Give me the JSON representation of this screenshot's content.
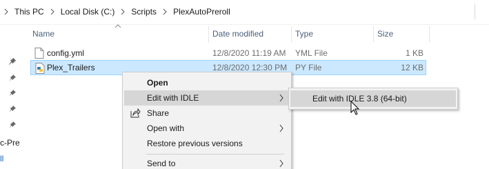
{
  "breadcrumb": [
    "This PC",
    "Local Disk (C:)",
    "Scripts",
    "PlexAutoPreroll"
  ],
  "nav_fragments": [
    "c-Pre",
    "ll"
  ],
  "columns": [
    "Name",
    "Date modified",
    "Type",
    "Size"
  ],
  "files": [
    {
      "name": "config.yml",
      "date": "12/8/2020 11:19 AM",
      "type": "YML File",
      "size": "1 KB",
      "icon": "yml-file-icon",
      "selected": false
    },
    {
      "name": "Plex_Trailers",
      "date": "12/8/2020 12:30 PM",
      "type": "PY File",
      "size": "12 KB",
      "icon": "python-file-icon",
      "selected": true
    }
  ],
  "context_menu": {
    "items": [
      {
        "label": "Open",
        "bold": true
      },
      {
        "label": "Edit with IDLE",
        "submenu": true,
        "hover": true
      },
      {
        "label": "Share",
        "icon": "share-icon"
      },
      {
        "label": "Open with",
        "submenu": true
      },
      {
        "label": "Restore previous versions"
      },
      {
        "label": "Send to",
        "submenu": true
      }
    ]
  },
  "submenu": {
    "label": "Edit with IDLE 3.8 (64-bit)"
  },
  "colors": {
    "selection_bg": "#cce8ff",
    "selection_border": "#99d1ff",
    "menu_bg": "#f2f2f2",
    "menu_hover": "#d6d6d6",
    "header_text": "#4c607a"
  }
}
